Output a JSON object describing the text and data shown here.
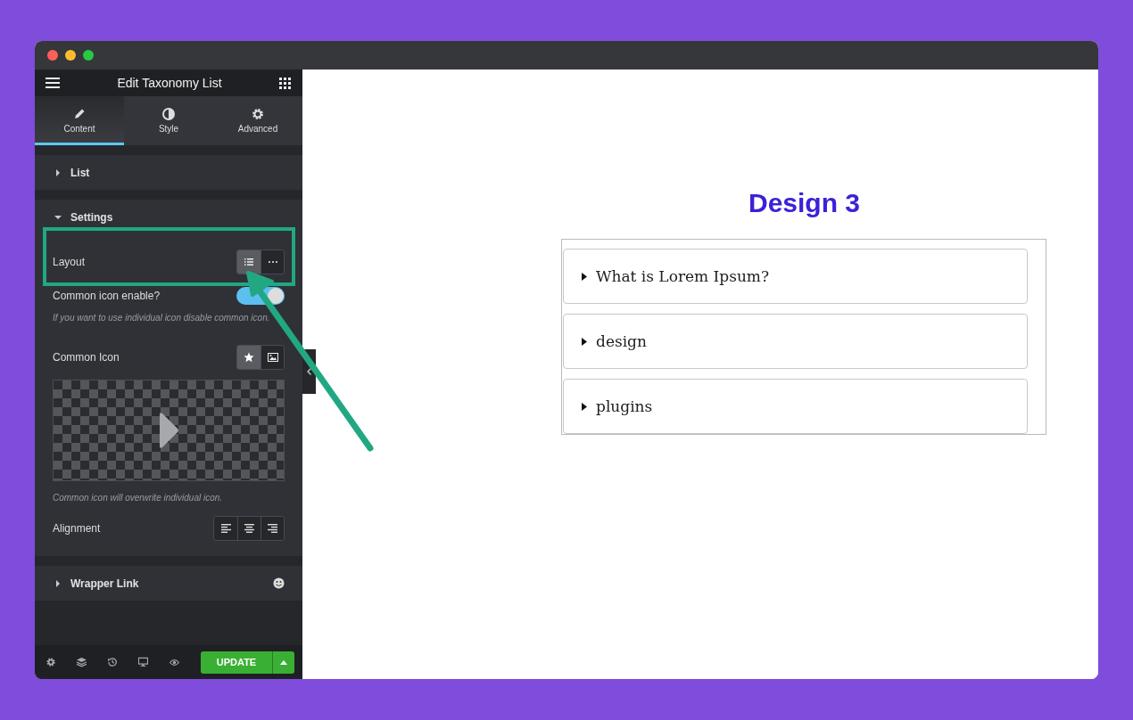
{
  "panel": {
    "title": "Edit Taxonomy List",
    "tabs": [
      {
        "label": "Content",
        "kind": "pencil",
        "selected": true
      },
      {
        "label": "Style",
        "kind": "contrast",
        "selected": false
      },
      {
        "label": "Advanced",
        "kind": "gear",
        "selected": false
      }
    ],
    "sections": [
      {
        "title": "List",
        "expanded": false,
        "kind": "plain"
      },
      {
        "title": "Settings",
        "expanded": true,
        "kind": "settings"
      },
      {
        "title": "Wrapper Link",
        "expanded": false,
        "kind": "dynamic"
      }
    ],
    "settings": {
      "layout": {
        "label": "Layout",
        "options": [
          {
            "kind": "list",
            "selected": true
          },
          {
            "kind": "dots",
            "selected": false
          }
        ]
      },
      "common_icon_enable": {
        "label": "Common icon enable?",
        "on": true,
        "hint": "If you want to use individual icon disable common icon."
      },
      "common_icon": {
        "label": "Common Icon",
        "options": [
          {
            "kind": "star",
            "selected": true
          },
          {
            "kind": "image",
            "selected": false
          }
        ],
        "hint": "Common icon will overwrite individual icon."
      },
      "alignment": {
        "label": "Alignment",
        "options": [
          {
            "kind": "left",
            "selected": false
          },
          {
            "kind": "center",
            "selected": false
          },
          {
            "kind": "right",
            "selected": false
          }
        ]
      }
    },
    "footer": {
      "tools": [
        {
          "kind": "gear"
        },
        {
          "kind": "layers"
        },
        {
          "kind": "history"
        },
        {
          "kind": "monitor"
        },
        {
          "kind": "eye"
        }
      ],
      "button": "UPDATE"
    }
  },
  "preview": {
    "heading": "Design 3",
    "items": [
      "What is Lorem Ipsum?",
      "design",
      "plugins"
    ]
  }
}
